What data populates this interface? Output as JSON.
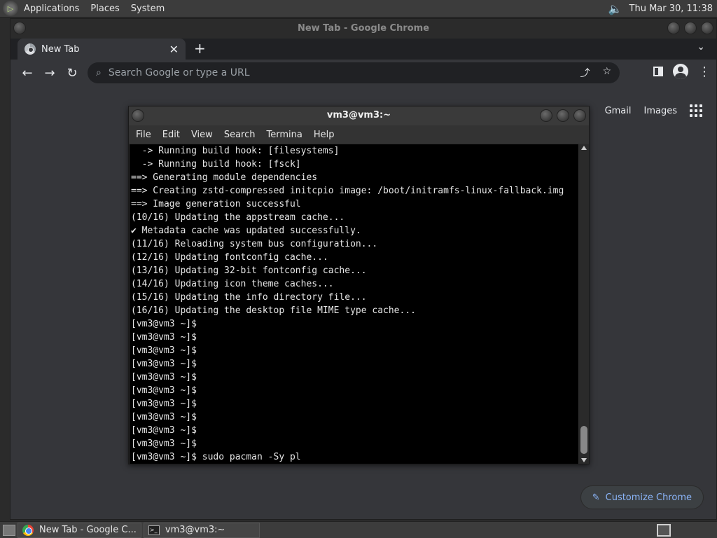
{
  "top_panel": {
    "menus": [
      "Applications",
      "Places",
      "System"
    ],
    "clock": "Thu Mar 30, 11:38",
    "volume_icon": "speaker-icon"
  },
  "chrome": {
    "window_title": "New Tab - Google Chrome",
    "tab_title": "New Tab",
    "omnibox_placeholder": "Search Google or type a URL",
    "ntp_links": {
      "gmail": "Gmail",
      "images": "Images"
    },
    "customize_label": "Customize Chrome",
    "icons": {
      "back": "←",
      "forward": "→",
      "reload": "↻",
      "search": "⌕",
      "share": "⤴",
      "star": "☆",
      "menu": "⋮",
      "tab_close": "✕",
      "new_tab": "+",
      "tab_list": "⌄",
      "pencil": "✎"
    }
  },
  "terminal": {
    "window_title": "vm3@vm3:~",
    "menu": [
      "File",
      "Edit",
      "View",
      "Search",
      "Termina",
      "Help"
    ],
    "lines": [
      "  -> Running build hook: [filesystems]",
      "  -> Running build hook: [fsck]",
      "==> Generating module dependencies",
      "==> Creating zstd-compressed initcpio image: /boot/initramfs-linux-fallback.img",
      "==> Image generation successful",
      "(10/16) Updating the appstream cache...",
      "✔ Metadata cache was updated successfully.",
      "(11/16) Reloading system bus configuration...",
      "(12/16) Updating fontconfig cache...",
      "(13/16) Updating 32-bit fontconfig cache...",
      "(14/16) Updating icon theme caches...",
      "(15/16) Updating the info directory file...",
      "(16/16) Updating the desktop file MIME type cache...",
      "[vm3@vm3 ~]$",
      "[vm3@vm3 ~]$",
      "[vm3@vm3 ~]$",
      "[vm3@vm3 ~]$",
      "[vm3@vm3 ~]$",
      "[vm3@vm3 ~]$",
      "[vm3@vm3 ~]$",
      "[vm3@vm3 ~]$",
      "[vm3@vm3 ~]$",
      "[vm3@vm3 ~]$",
      "[vm3@vm3 ~]$ sudo pacman -Sy pl"
    ]
  },
  "taskbar": {
    "tasks": [
      "New Tab - Google C...",
      "vm3@vm3:~"
    ]
  }
}
